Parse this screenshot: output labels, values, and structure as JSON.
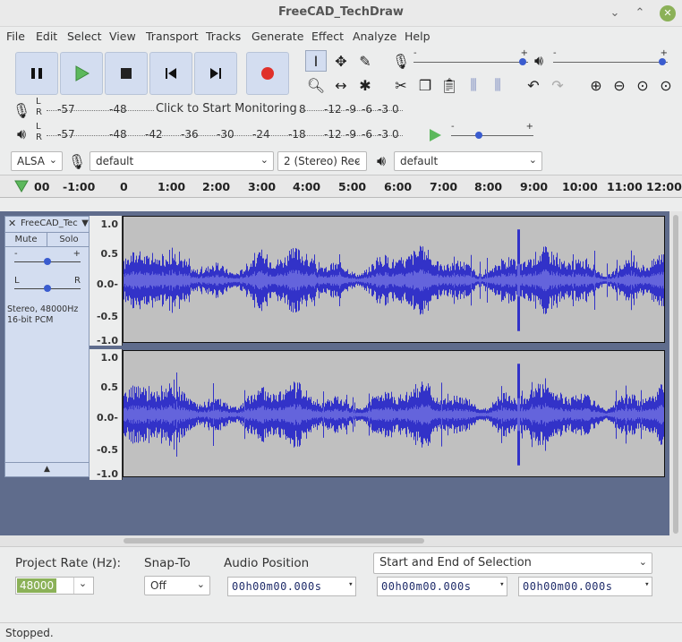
{
  "window": {
    "title": "FreeCAD_TechDraw",
    "min_icon": "minimize-icon",
    "max_icon": "maximize-icon",
    "close_icon": "close-icon"
  },
  "menu": [
    "File",
    "Edit",
    "Select",
    "View",
    "Transport",
    "Tracks",
    "Generate",
    "Effect",
    "Analyze",
    "Help"
  ],
  "transport": {
    "pause": "pause-icon",
    "play": "play-icon",
    "stop": "stop-icon",
    "skip_start": "skip-to-start-icon",
    "skip_end": "skip-to-end-icon",
    "record": "record-icon"
  },
  "tools": [
    "selection-tool-icon",
    "envelope-tool-icon",
    "draw-tool-icon",
    "zoom-tool-icon",
    "timeshift-tool-icon",
    "multi-tool-icon"
  ],
  "edit_tools": [
    "cut-icon",
    "copy-icon",
    "paste-icon",
    "trim-icon",
    "silence-icon",
    "undo-icon",
    "redo-icon",
    "zoom-in-icon",
    "zoom-out-icon",
    "fit-selection-icon",
    "fit-project-icon"
  ],
  "record_meter": {
    "lr": [
      "L",
      "R"
    ],
    "ticks": [
      "-57",
      "-48",
      "8",
      "-12",
      "-9",
      "-6",
      "-3",
      "0"
    ],
    "monitor_text": "Click to Start Monitoring"
  },
  "play_meter": {
    "lr": [
      "L",
      "R"
    ],
    "ticks": [
      "-57",
      "-48",
      "-42",
      "-36",
      "-30",
      "-24",
      "-18",
      "-12",
      "-9",
      "-6",
      "-3",
      "0"
    ]
  },
  "sliders": {
    "record_min": "-",
    "record_max": "+",
    "play_min": "-",
    "play_max": "+"
  },
  "device": {
    "host": "ALSA",
    "rec_device": "default",
    "channels": "2 (Stereo) Rec",
    "play_device": "default"
  },
  "ruler": {
    "ticks": [
      "00",
      "-1:00",
      "0",
      "1:00",
      "2:00",
      "3:00",
      "4:00",
      "5:00",
      "6:00",
      "7:00",
      "8:00",
      "9:00",
      "10:00",
      "11:00",
      "12:00"
    ]
  },
  "track": {
    "name": "FreeCAD_Tec",
    "mute": "Mute",
    "solo": "Solo",
    "gain_min": "-",
    "gain_max": "+",
    "pan_left": "L",
    "pan_right": "R",
    "info_line1": "Stereo, 48000Hz",
    "info_line2": "16-bit PCM",
    "close": "✕",
    "menu_arrow": "▼",
    "collapse": "▲",
    "scale": [
      "1.0",
      "0.5",
      "0.0-",
      "-0.5",
      "-1.0"
    ]
  },
  "selectionbar": {
    "rate_label": "Project Rate (Hz):",
    "rate_value": "48000",
    "snap_label": "Snap-To",
    "snap_value": "Off",
    "audio_pos_label": "Audio Position",
    "selection_mode": "Start and End of Selection",
    "audio_pos_value": "00h00m00.000s",
    "sel_start_value": "00h00m00.000s",
    "sel_end_value": "00h00m00.000s"
  },
  "status": "Stopped.",
  "colors": {
    "waveform": "#3232c8",
    "waveform_rms": "#6464dc",
    "track_bg": "#5f6c8c",
    "button_bg": "#d3ddf0"
  }
}
